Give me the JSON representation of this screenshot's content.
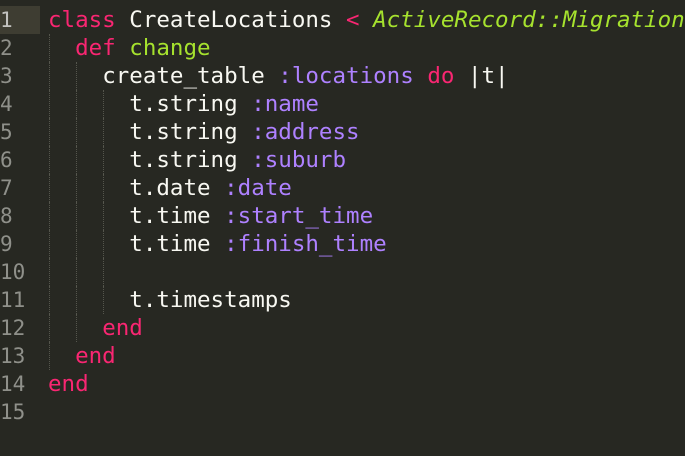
{
  "editor": {
    "colors": {
      "background": "#272822",
      "keyword": "#f92672",
      "function_name": "#a6e22e",
      "symbol": "#ae81ff",
      "text": "#f8f8f2",
      "line_number": "#8f908a"
    },
    "line_numbers": [
      "1",
      "2",
      "3",
      "4",
      "5",
      "6",
      "7",
      "8",
      "9",
      "10",
      "11",
      "12",
      "13",
      "14",
      "15"
    ],
    "lines": [
      {
        "tokens": [
          {
            "t": "class",
            "c": "kw"
          },
          {
            "t": " ",
            "c": "plain"
          },
          {
            "t": "CreateLocations",
            "c": "cls"
          },
          {
            "t": " ",
            "c": "plain"
          },
          {
            "t": "<",
            "c": "op"
          },
          {
            "t": " ",
            "c": "plain"
          },
          {
            "t": "ActiveRecord::Migration",
            "c": "inh"
          }
        ],
        "indent": 0
      },
      {
        "tokens": [
          {
            "t": "  ",
            "c": "plain"
          },
          {
            "t": "def",
            "c": "kw"
          },
          {
            "t": " ",
            "c": "plain"
          },
          {
            "t": "change",
            "c": "fn"
          }
        ],
        "indent": 1
      },
      {
        "tokens": [
          {
            "t": "    ",
            "c": "plain"
          },
          {
            "t": "create_table",
            "c": "plain"
          },
          {
            "t": " ",
            "c": "plain"
          },
          {
            "t": ":locations",
            "c": "sym"
          },
          {
            "t": " ",
            "c": "plain"
          },
          {
            "t": "do",
            "c": "kw"
          },
          {
            "t": " ",
            "c": "plain"
          },
          {
            "t": "|t|",
            "c": "plain"
          }
        ],
        "indent": 2
      },
      {
        "tokens": [
          {
            "t": "      ",
            "c": "plain"
          },
          {
            "t": "t.string",
            "c": "plain"
          },
          {
            "t": " ",
            "c": "plain"
          },
          {
            "t": ":name",
            "c": "sym"
          }
        ],
        "indent": 3
      },
      {
        "tokens": [
          {
            "t": "      ",
            "c": "plain"
          },
          {
            "t": "t.string",
            "c": "plain"
          },
          {
            "t": " ",
            "c": "plain"
          },
          {
            "t": ":address",
            "c": "sym"
          }
        ],
        "indent": 3
      },
      {
        "tokens": [
          {
            "t": "      ",
            "c": "plain"
          },
          {
            "t": "t.string",
            "c": "plain"
          },
          {
            "t": " ",
            "c": "plain"
          },
          {
            "t": ":suburb",
            "c": "sym"
          }
        ],
        "indent": 3
      },
      {
        "tokens": [
          {
            "t": "      ",
            "c": "plain"
          },
          {
            "t": "t.date",
            "c": "plain"
          },
          {
            "t": " ",
            "c": "plain"
          },
          {
            "t": ":date",
            "c": "sym"
          }
        ],
        "indent": 3
      },
      {
        "tokens": [
          {
            "t": "      ",
            "c": "plain"
          },
          {
            "t": "t.time",
            "c": "plain"
          },
          {
            "t": " ",
            "c": "plain"
          },
          {
            "t": ":start_time",
            "c": "sym"
          }
        ],
        "indent": 3
      },
      {
        "tokens": [
          {
            "t": "      ",
            "c": "plain"
          },
          {
            "t": "t.time",
            "c": "plain"
          },
          {
            "t": " ",
            "c": "plain"
          },
          {
            "t": ":finish_time",
            "c": "sym"
          }
        ],
        "indent": 3
      },
      {
        "tokens": [],
        "indent": 3
      },
      {
        "tokens": [
          {
            "t": "      ",
            "c": "plain"
          },
          {
            "t": "t.timestamps",
            "c": "plain"
          }
        ],
        "indent": 3
      },
      {
        "tokens": [
          {
            "t": "    ",
            "c": "plain"
          },
          {
            "t": "end",
            "c": "kw"
          }
        ],
        "indent": 2
      },
      {
        "tokens": [
          {
            "t": "  ",
            "c": "plain"
          },
          {
            "t": "end",
            "c": "kw"
          }
        ],
        "indent": 1
      },
      {
        "tokens": [
          {
            "t": "end",
            "c": "kw"
          }
        ],
        "indent": 0
      },
      {
        "tokens": [],
        "indent": 0
      }
    ]
  }
}
